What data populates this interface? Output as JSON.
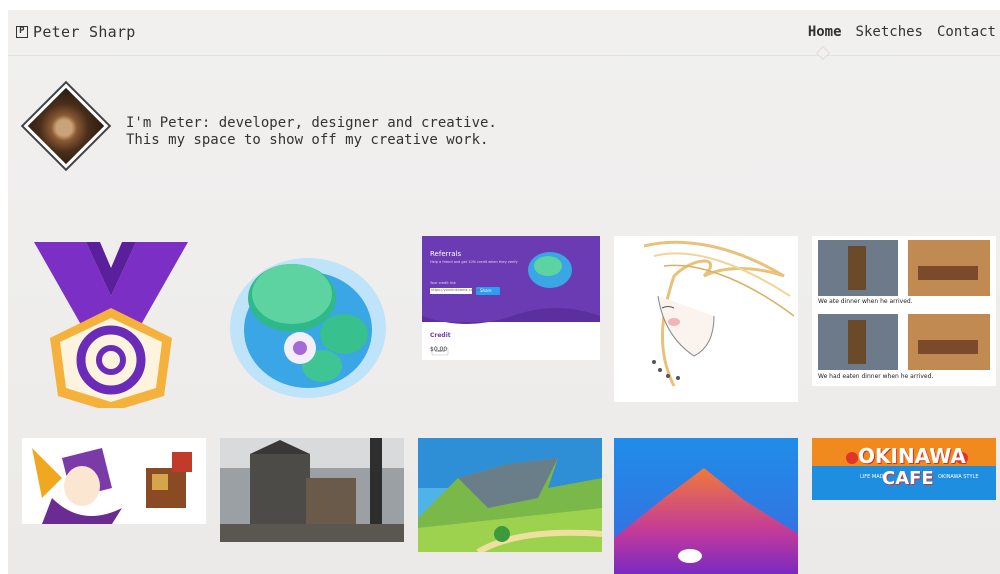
{
  "brand": {
    "name": "Peter Sharp",
    "icon": "p-logo-icon"
  },
  "nav": {
    "items": [
      {
        "label": "Home",
        "active": true
      },
      {
        "label": "Sketches",
        "active": false
      },
      {
        "label": "Contact",
        "active": false
      }
    ]
  },
  "intro": {
    "line1": "I'm Peter: developer, designer and creative.",
    "line2": "This my space to show off my creative work."
  },
  "referrals": {
    "title": "Referrals",
    "subtitle": "Help a friend and get 10% credit when they verify",
    "field_label": "Your credit link",
    "field_value": "https://yourlinkname.co.nz/ref",
    "share_label": "Share",
    "credit_label": "Credit",
    "credit_value": "$0.00",
    "claim_label": "Claim"
  },
  "comic": {
    "caption1": "We ate dinner when he arrived.",
    "caption2": "We had eaten dinner when he arrived."
  },
  "okinawa": {
    "title_top": "OKINAWA",
    "title_bottom": "CAFE",
    "left_tag": "LIFE MADE",
    "right_tag": "OKINAWA STYLE"
  },
  "colors": {
    "accent_purple": "#6a2cb8",
    "water_blue": "#3aa6e6",
    "sky_blue": "#2aa0f0",
    "okinawa_orange": "#f08a1e"
  }
}
